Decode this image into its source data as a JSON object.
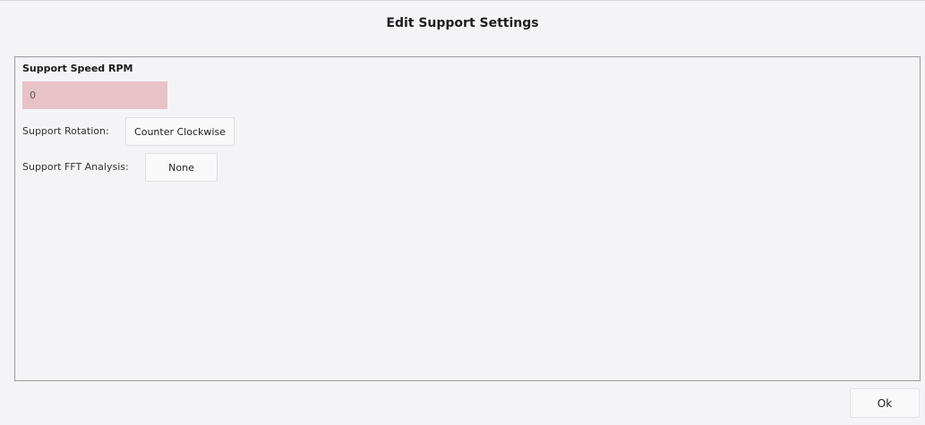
{
  "dialog": {
    "title": "Edit Support Settings"
  },
  "support": {
    "speed_label": "Support Speed RPM",
    "speed_value": "0",
    "rotation_label": "Support Rotation:",
    "rotation_value": "Counter Clockwise",
    "fft_label": "Support FFT Analysis:",
    "fft_value": "None"
  },
  "footer": {
    "ok_label": "Ok"
  },
  "colors": {
    "background": "#f4f4f6",
    "invalid_input_background": "#e8c2c9",
    "panel_border": "#9a9a9e"
  }
}
